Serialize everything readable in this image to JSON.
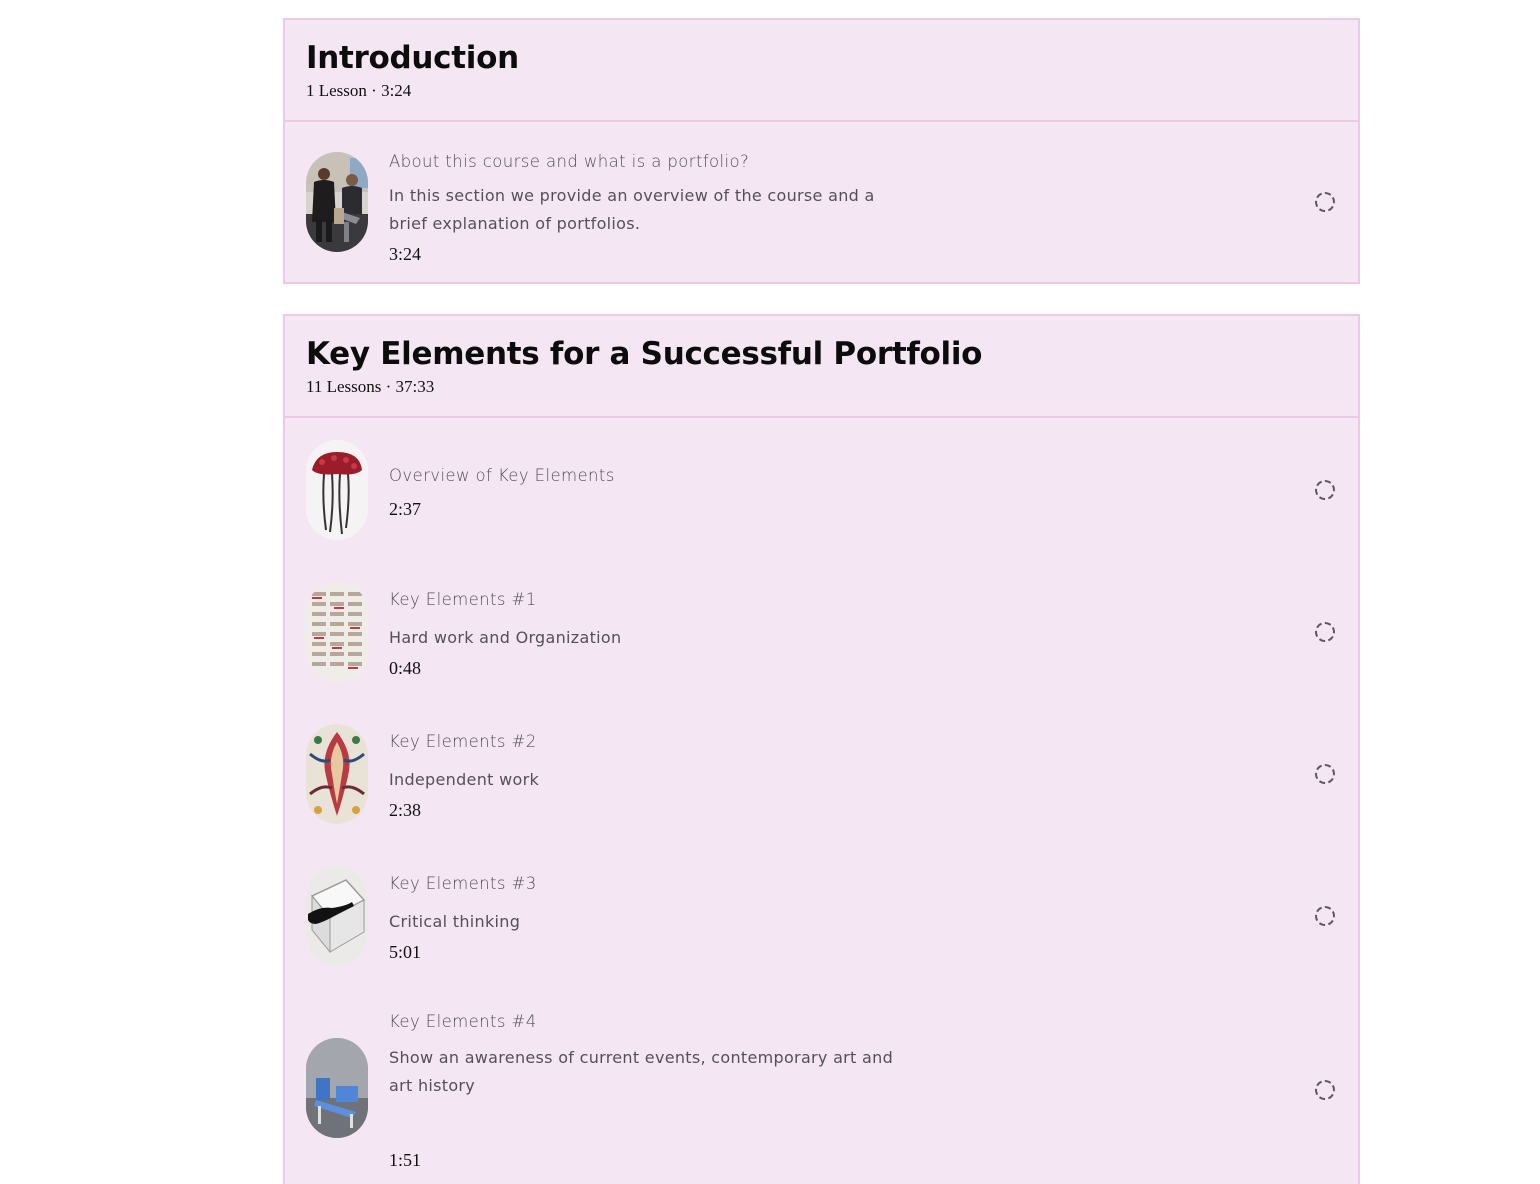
{
  "sections": [
    {
      "title": "Introduction",
      "meta": "1 Lesson · 3:24",
      "lessons": [
        {
          "title": "About this course and what is a portfolio?",
          "description": "In this section we provide an overview of the course and a brief explanation of portfolios.",
          "duration": "3:24",
          "status_icon": "incomplete-circle-icon"
        }
      ]
    },
    {
      "title": "Key Elements for a Successful Portfolio",
      "meta": "11 Lessons · 37:33",
      "lessons": [
        {
          "title": "Overview of Key Elements",
          "description": "",
          "duration": "2:37",
          "status_icon": "incomplete-circle-icon"
        },
        {
          "title": "Key Elements #1",
          "description": "Hard work and Organization",
          "duration": "0:48",
          "status_icon": "incomplete-circle-icon"
        },
        {
          "title": "Key Elements #2",
          "description": "Independent work",
          "duration": "2:38",
          "status_icon": "incomplete-circle-icon"
        },
        {
          "title": "Key Elements #3",
          "description": "Critical thinking",
          "duration": "5:01",
          "status_icon": "incomplete-circle-icon"
        },
        {
          "title": "Key Elements #4",
          "description": "Show an awareness of current events, contemporary art and art history",
          "duration": "1:51",
          "status_icon": "incomplete-circle-icon"
        }
      ]
    }
  ],
  "colors": {
    "card_background": "#f4e6f3",
    "card_border": "#ecc9e6",
    "heading_text": "#0c0c0c",
    "body_text": "#555058"
  }
}
